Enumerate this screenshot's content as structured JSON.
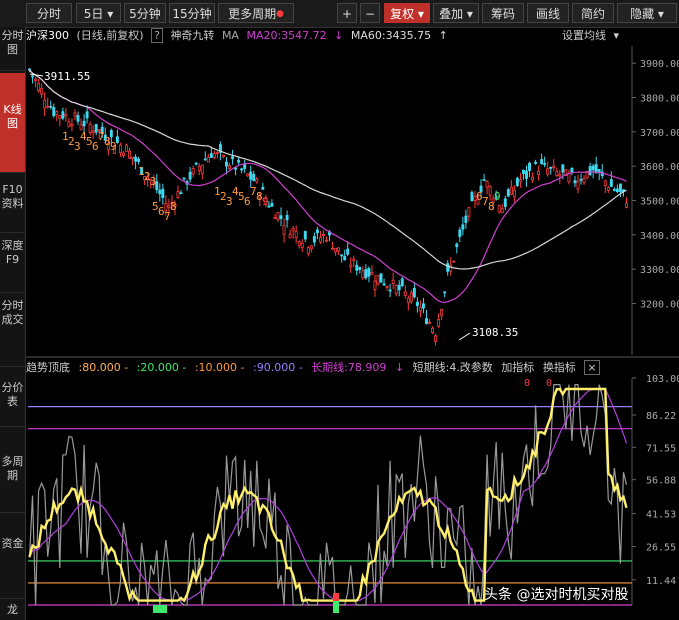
{
  "toolbar": {
    "buttons": [
      "分时",
      "5日",
      "5分钟",
      "15分钟",
      "更多周期",
      "复权",
      "叠加",
      "筹码",
      "画线",
      "简约",
      "隐藏"
    ],
    "plus": "+",
    "minus": "−",
    "caret": "▾"
  },
  "sidebar": {
    "items": [
      "分时图",
      "K线图",
      "F10资料",
      "深度F9",
      "分时成交",
      "分价表",
      "多周期",
      "资金",
      "龙"
    ]
  },
  "info": {
    "symbol": "沪深300",
    "mode": "(日线,前复权)",
    "help": "?",
    "indicator_name": "神奇九转",
    "ma_prefix": "MA",
    "ma20": "MA20:3547.72",
    "ma60": "MA60:3435.75",
    "settings": "设置均线"
  },
  "price_axis": [
    "3900.00",
    "3800.00",
    "3700.00",
    "3600.00",
    "3500.00",
    "3400.00",
    "3300.00",
    "3200.00"
  ],
  "annotations": {
    "high": "3911.55",
    "low": "3108.35"
  },
  "indicator": {
    "name": "趋势顶底",
    "l1": ":80.000 -",
    "l2": ":20.000 -",
    "l3": ":10.000 -",
    "l4": ":90.000 -",
    "long": "长期线:78.909",
    "short": "短期线:4.改参数",
    "add": "加指标",
    "switch": "换指标",
    "close": "×"
  },
  "ind_axis": [
    "103.00",
    "86.22",
    "71.55",
    "56.88",
    "41.53",
    "26.55",
    "11.44"
  ],
  "colors": {
    "accent": "#c0302a",
    "up": "#ff3b3b",
    "down": "#3fd8f0",
    "ma20": "#d040d0",
    "ma60": "#d8d8d8"
  },
  "watermark": "头条 @选对时机买对股"
}
